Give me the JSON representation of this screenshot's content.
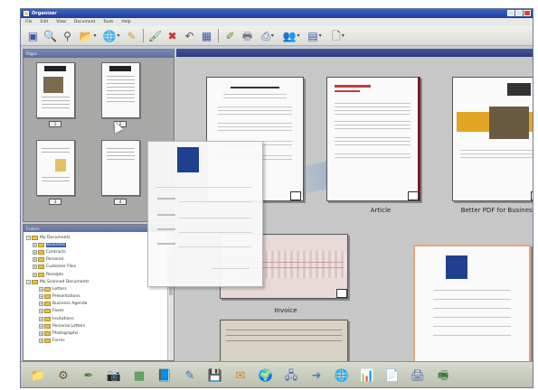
{
  "window": {
    "title": "Organizer"
  },
  "menu": [
    "File",
    "Edit",
    "View",
    "Document",
    "Tools",
    "Help"
  ],
  "toolbar": {
    "buttons": [
      {
        "name": "new-icon",
        "glyph": "▣"
      },
      {
        "name": "search-icon",
        "glyph": "🔍"
      },
      {
        "name": "binoculars-icon",
        "glyph": "⚲"
      },
      {
        "name": "folder-open-icon",
        "glyph": "📂"
      },
      {
        "name": "globe-icon",
        "glyph": "🌐"
      },
      {
        "name": "pen-icon",
        "glyph": "✎"
      },
      {
        "name": "brush-icon",
        "glyph": "🖌"
      },
      {
        "name": "delete-icon",
        "glyph": "✖"
      },
      {
        "name": "undo-icon",
        "glyph": "↶"
      },
      {
        "name": "layout-icon",
        "glyph": "▦"
      },
      {
        "name": "highlighter-icon",
        "glyph": "✐"
      },
      {
        "name": "print-icon",
        "glyph": "🖶"
      },
      {
        "name": "stamp-icon",
        "glyph": "⎙"
      },
      {
        "name": "people-icon",
        "glyph": "👥"
      },
      {
        "name": "view-icon",
        "glyph": "▤"
      },
      {
        "name": "page-icon",
        "glyph": "🗋"
      }
    ]
  },
  "thumb_pane": {
    "header": "Pages"
  },
  "folder_pane": {
    "header": "Folders",
    "items": [
      {
        "label": "My Documents",
        "indent": 0,
        "expanded": true
      },
      {
        "label": "Business",
        "indent": 1,
        "selected": true
      },
      {
        "label": "Contracts",
        "indent": 1
      },
      {
        "label": "Personal",
        "indent": 1
      },
      {
        "label": "Customer Files",
        "indent": 1
      },
      {
        "label": "Receipts",
        "indent": 1
      },
      {
        "label": "My Scanned Documents",
        "indent": 0,
        "expanded": true
      },
      {
        "label": "Letters",
        "indent": 2
      },
      {
        "label": "Presentations",
        "indent": 2
      },
      {
        "label": "Business Agenda",
        "indent": 2
      },
      {
        "label": "Faxes",
        "indent": 2
      },
      {
        "label": "Invitations",
        "indent": 2
      },
      {
        "label": "Personal Letters",
        "indent": 2
      },
      {
        "label": "Photographs",
        "indent": 2
      },
      {
        "label": "Forms",
        "indent": 2
      }
    ]
  },
  "main_pane": {
    "documents": [
      {
        "caption": "",
        "name": "document-1"
      },
      {
        "caption": "Article",
        "name": "document-article"
      },
      {
        "caption": "Better PDF for Business",
        "name": "document-better-pdf"
      },
      {
        "caption": "Invoice",
        "name": "document-invoice"
      },
      {
        "caption": "",
        "name": "document-form"
      },
      {
        "caption": "",
        "name": "document-scan"
      }
    ]
  },
  "taskbar": {
    "icons": [
      {
        "name": "folder-icon",
        "glyph": "📁",
        "color": "#e3a72a"
      },
      {
        "name": "tools-icon",
        "glyph": "⚙",
        "color": "#6d5a3a"
      },
      {
        "name": "pen-tool-icon",
        "glyph": "✒",
        "color": "#4a7a3a"
      },
      {
        "name": "camera-icon",
        "glyph": "📷",
        "color": "#333333"
      },
      {
        "name": "spreadsheet-icon",
        "glyph": "▦",
        "color": "#2f8a3a"
      },
      {
        "name": "book-icon",
        "glyph": "📘",
        "color": "#4a4fa8"
      },
      {
        "name": "edit-icon",
        "glyph": "✎",
        "color": "#3b78b8"
      },
      {
        "name": "disk-icon",
        "glyph": "💾",
        "color": "#3a6cb0"
      },
      {
        "name": "mail-icon",
        "glyph": "✉",
        "color": "#d18a2a"
      },
      {
        "name": "globe-icon",
        "glyph": "🌍",
        "color": "#2e8a4a"
      },
      {
        "name": "network-icon",
        "glyph": "🖧",
        "color": "#4a6ab8"
      },
      {
        "name": "arrow-icon",
        "glyph": "➜",
        "color": "#5a7ab8"
      },
      {
        "name": "earth-icon",
        "glyph": "🌐",
        "color": "#2e6ab0"
      },
      {
        "name": "chart-icon",
        "glyph": "📊",
        "color": "#c43a3a"
      },
      {
        "name": "document-icon",
        "glyph": "📄",
        "color": "#6aa84f"
      },
      {
        "name": "printer-icon",
        "glyph": "🖨",
        "color": "#4a6ab8"
      },
      {
        "name": "scanner-icon",
        "glyph": "🖷",
        "color": "#3a7a3a"
      }
    ]
  }
}
